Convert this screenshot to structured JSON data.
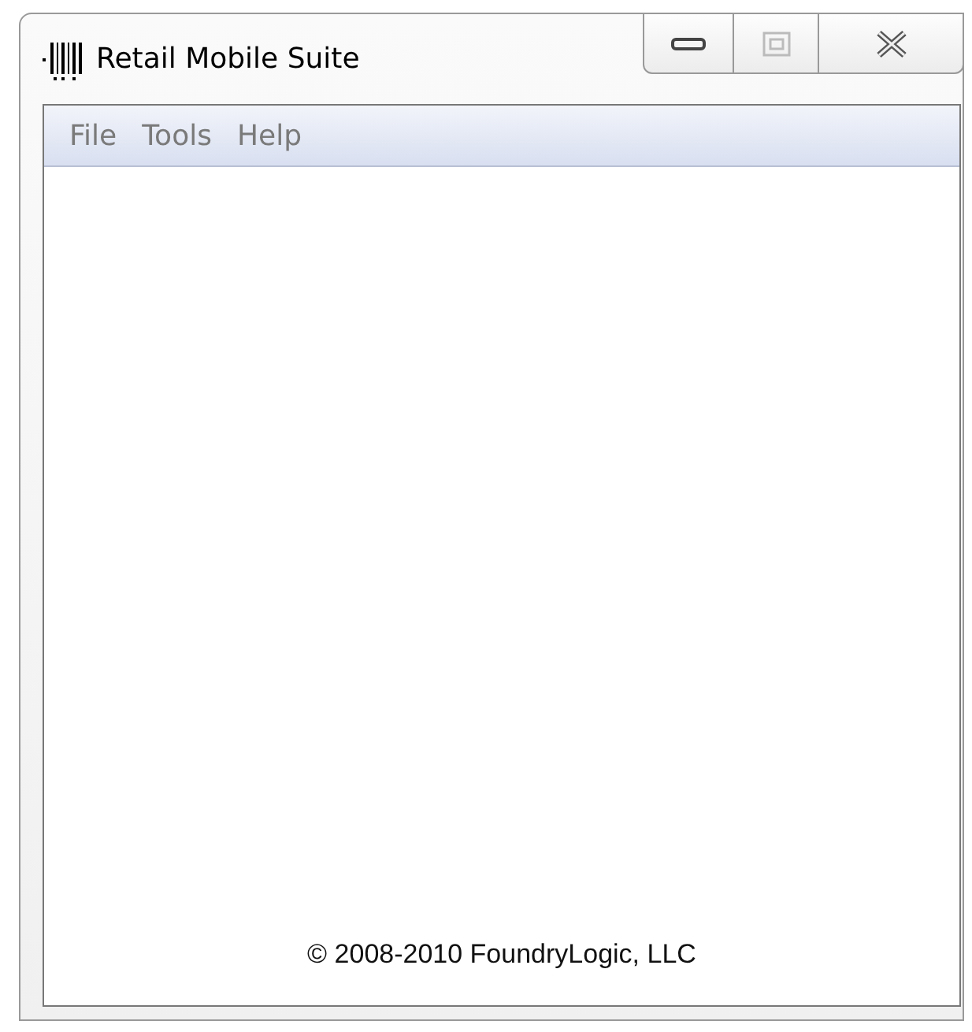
{
  "window": {
    "title": "Retail Mobile Suite"
  },
  "menu": [
    {
      "label": "File",
      "disabled": true
    },
    {
      "label": "Tools",
      "disabled": true
    },
    {
      "label": "Help",
      "disabled": true
    }
  ],
  "footer": "© 2008-2010 FoundryLogic, LLC"
}
